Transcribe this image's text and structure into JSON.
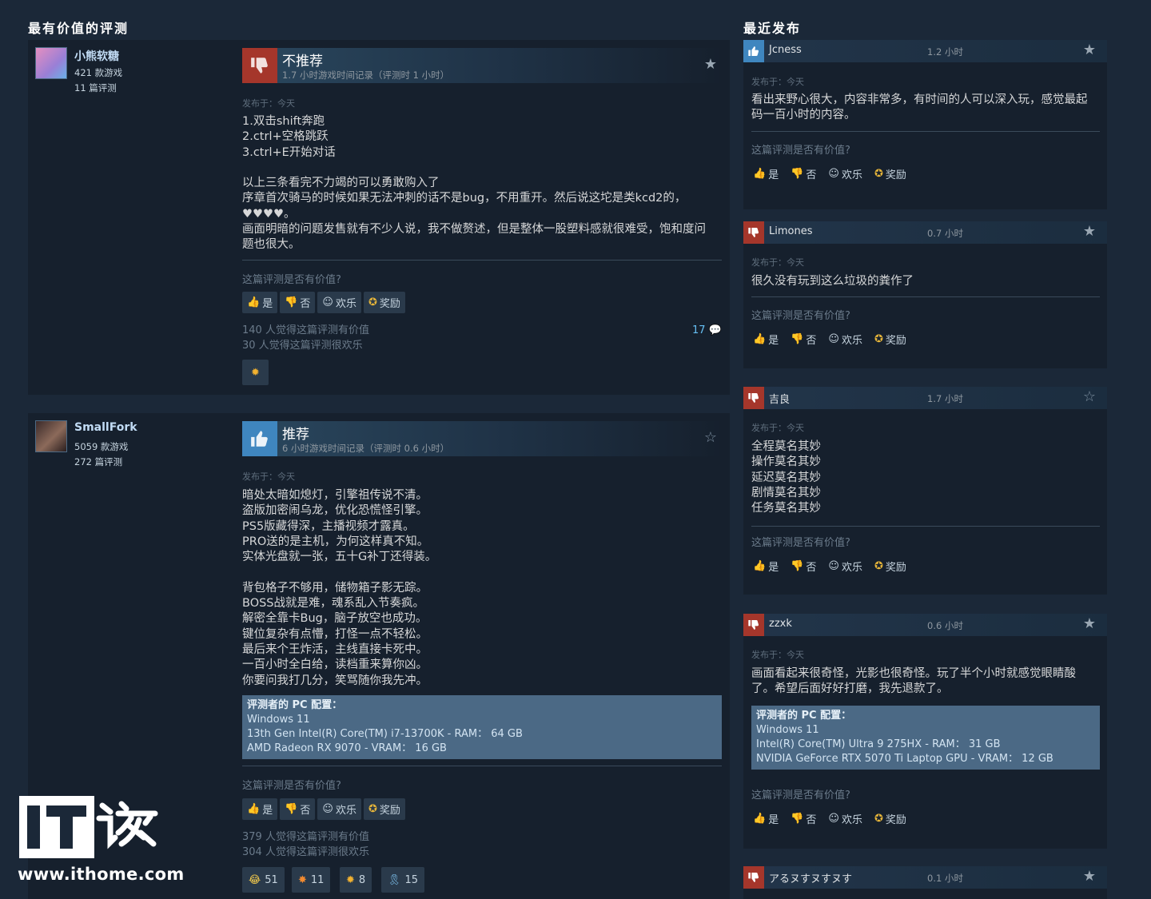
{
  "left_title": "最有价值的评测",
  "right_title": "最近发布",
  "helpful_question": "这篇评测是否有价值?",
  "buttons": {
    "yes": "是",
    "no": "否",
    "funny": "欢乐",
    "award": "奖励"
  },
  "reviews": [
    {
      "user": "小熊软糖",
      "games": "421 款游戏",
      "reviews": "11 篇评测",
      "verdict": "不推荐",
      "hours": "1.7 小时游戏时间记录（评测时 1 小时）",
      "posted": "发布于：今天",
      "body": "1.双击shift奔跑\n2.ctrl+空格跳跃\n3.ctrl+E开始对话\n\n以上三条看完不力竭的可以勇敢购入了\n序章首次骑马的时候如果无法冲刺的话不是bug，不用重开。然后说这坨是类kcd2的，\n♥♥♥♥。\n画面明暗的问题发售就有不少人说，我不做赘述，但是整体一股塑料感就很难受，饱和度问\n题也很大。",
      "helpful": "140 人觉得这篇评测有价值",
      "funny": "30 人觉得这篇评测很欢乐",
      "comments": "17"
    },
    {
      "user": "SmallFork",
      "games": "5059 款游戏",
      "reviews": "272 篇评测",
      "verdict": "推荐",
      "hours": "6 小时游戏时间记录（评测时 0.6 小时）",
      "posted": "发布于：今天",
      "body": "暗处太暗如熄灯，引擎祖传说不清。\n盗版加密闹乌龙，优化恐慌怪引擎。\nPS5版藏得深，主播视频才露真。\nPRO送的是主机，为何这样真不知。\n实体光盘就一张，五十G补丁还得装。\n\n背包格子不够用，储物箱子影无踪。\nBOSS战就是难，魂系乱入节奏疯。\n解密全靠卡Bug，脑子放空也成功。\n键位复杂有点懵，打怪一点不轻松。\n最后来个王炸活，主线直接卡死中。\n一百小时全白给，读档重来算你凶。\n你要问我打几分，笑骂随你我先冲。",
      "pc_title": "评测者的 PC 配置：",
      "pc_lines": [
        "Windows 11",
        "13th Gen Intel(R) Core(TM) i7-13700K - RAM： 64 GB",
        "AMD Radeon RX 9070 - VRAM： 16 GB"
      ],
      "helpful": "379 人觉得这篇评测有价值",
      "funny": "304 人觉得这篇评测很欢乐",
      "awards": [
        "51",
        "11",
        "8",
        "15"
      ]
    }
  ],
  "recent": [
    {
      "user": "Jcness",
      "hours": "1.2 小时",
      "posted": "发布于：今天",
      "body": "看出来野心很大，内容非常多，有时间的人可以深入玩，感觉最起\n码一百小时的内容。"
    },
    {
      "user": "Limones",
      "hours": "0.7 小时",
      "posted": "发布于：今天",
      "body": "很久没有玩到这么垃圾的粪作了"
    },
    {
      "user": "吉良",
      "hours": "1.7 小时",
      "posted": "发布于：今天",
      "body": "全程莫名其妙\n操作莫名其妙\n延迟莫名其妙\n剧情莫名其妙\n任务莫名其妙"
    },
    {
      "user": "zzxk",
      "hours": "0.6 小时",
      "posted": "发布于：今天",
      "body": "画面看起来很奇怪，光影也很奇怪。玩了半个小时就感觉眼睛酸\n了。希望后面好好打磨，我先退款了。",
      "pc_title": "评测者的 PC 配置：",
      "pc_lines": [
        "Windows 11",
        "Intel(R) Core(TM) Ultra 9 275HX - RAM： 31 GB",
        "NVIDIA GeForce RTX 5070 Ti Laptop GPU - VRAM： 12 GB"
      ]
    },
    {
      "user": "アるヌすヌすヌす",
      "hours": "0.1 小时"
    }
  ],
  "watermark": {
    "brand": "IT之家",
    "site": "www.ithome.com"
  }
}
